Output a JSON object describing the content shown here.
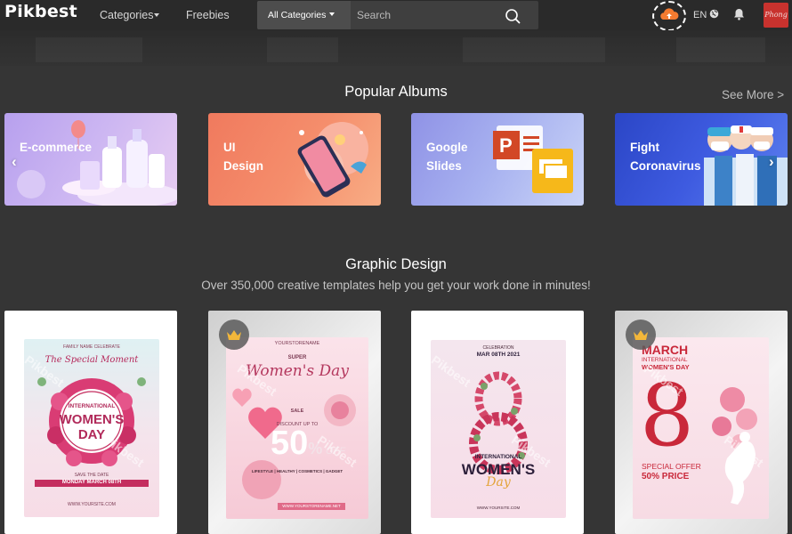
{
  "header": {
    "logo": "Pikbest",
    "nav": [
      {
        "label": "Categories",
        "has_caret": true
      },
      {
        "label": "Freebies",
        "has_caret": false
      }
    ],
    "category_select": "All Categories",
    "search_placeholder": "Search",
    "language": "EN",
    "avatar_text": "Phong",
    "colors": {
      "nav_bg": "#2a2a2a",
      "cloud": "#f47b30",
      "avatar": "#c8322e"
    }
  },
  "albums": {
    "title": "Popular Albums",
    "see_more": "See More >",
    "items": [
      {
        "label": "E-commerce",
        "gradient": [
          "#b9a2ee",
          "#e6c7f2"
        ]
      },
      {
        "label": "UI\nDesign",
        "gradient": [
          "#f07a5e",
          "#f6a278"
        ]
      },
      {
        "label": "Google\nSlides",
        "gradient": [
          "#8c92e6",
          "#c6d0f6"
        ]
      },
      {
        "label": "Fight\nCoronavirus",
        "gradient": [
          "#2a47c8",
          "#5478ee"
        ]
      }
    ]
  },
  "graphic_design": {
    "title": "Graphic Design",
    "subtitle": "Over 350,000 creative templates help you get your work done in minutes!"
  },
  "templates": [
    {
      "premium": false,
      "texts": {
        "top": "FAMILY NAME CELEBRATE",
        "script": "The Special Moment",
        "line1": "INTERNATIONAL",
        "line2": "WOMEN'S",
        "line3": "DAY",
        "save": "SAVE THE DATE",
        "date": "MONDAY MARCH 08TH",
        "site": "WWW.YOURSITE.COM"
      }
    },
    {
      "premium": true,
      "texts": {
        "store": "YOURSTORENAME",
        "super": "SUPER",
        "script": "Women's Day",
        "sale": "SALE",
        "discount": "DISCOUNT UP TO",
        "percent": "50",
        "percent_sign": "%",
        "off": "OFF",
        "cats": "LIFESTYLE | HEALTHY | COSMETICS | GADGET",
        "site": "WWW.YOURSTORENAME.NET"
      }
    },
    {
      "premium": false,
      "texts": {
        "celebration": "CELEBRATION",
        "date": "MAR 08TH 2021",
        "line1": "INTERNATIONAL",
        "line2": "WOMEN'S",
        "script": "Day",
        "site": "WWW.YOURSITE.COM"
      }
    },
    {
      "premium": true,
      "texts": {
        "month": "MARCH",
        "line1": "INTERNATIONAL",
        "line2": "WOMEN'S DAY",
        "digit": "8",
        "offer": "SPECIAL OFFER",
        "price": "50% PRICE"
      }
    }
  ],
  "watermark": "Pikbest"
}
